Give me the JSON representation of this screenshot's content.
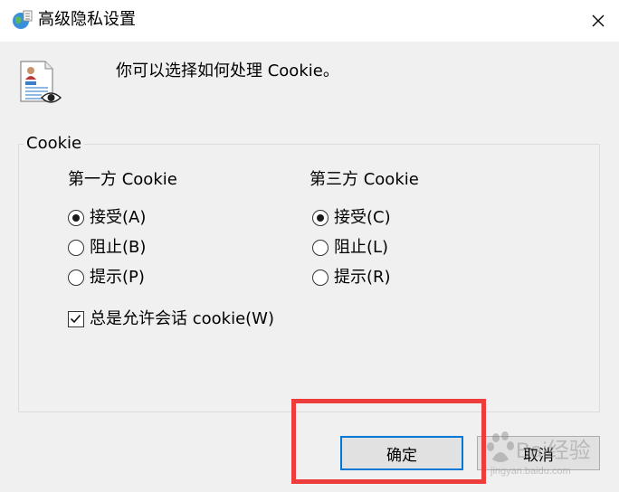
{
  "window": {
    "title": "高级隐私设置",
    "close_glyph": "✕"
  },
  "prompt": "你可以选择如何处理 Cookie。",
  "group": {
    "legend": "Cookie",
    "first_party": {
      "heading": "第一方 Cookie",
      "options": [
        "接受(A)",
        "阻止(B)",
        "提示(P)"
      ],
      "selected": "接受(A)"
    },
    "third_party": {
      "heading": "第三方 Cookie",
      "options": [
        "接受(C)",
        "阻止(L)",
        "提示(R)"
      ],
      "selected": "接受(C)"
    },
    "session_cookie": {
      "label": "总是允许会话 cookie(W)",
      "checked": true
    }
  },
  "buttons": {
    "ok": "确定",
    "cancel": "取消"
  },
  "watermark": {
    "text": "Bai经验",
    "sub": "jingyan.baidu.com"
  },
  "colors": {
    "focus_border": "#0078d7",
    "highlight": "#ee3b3b"
  },
  "icons": [
    "ie-globe-icon",
    "privacy-document-icon",
    "eye-icon",
    "close-icon"
  ]
}
